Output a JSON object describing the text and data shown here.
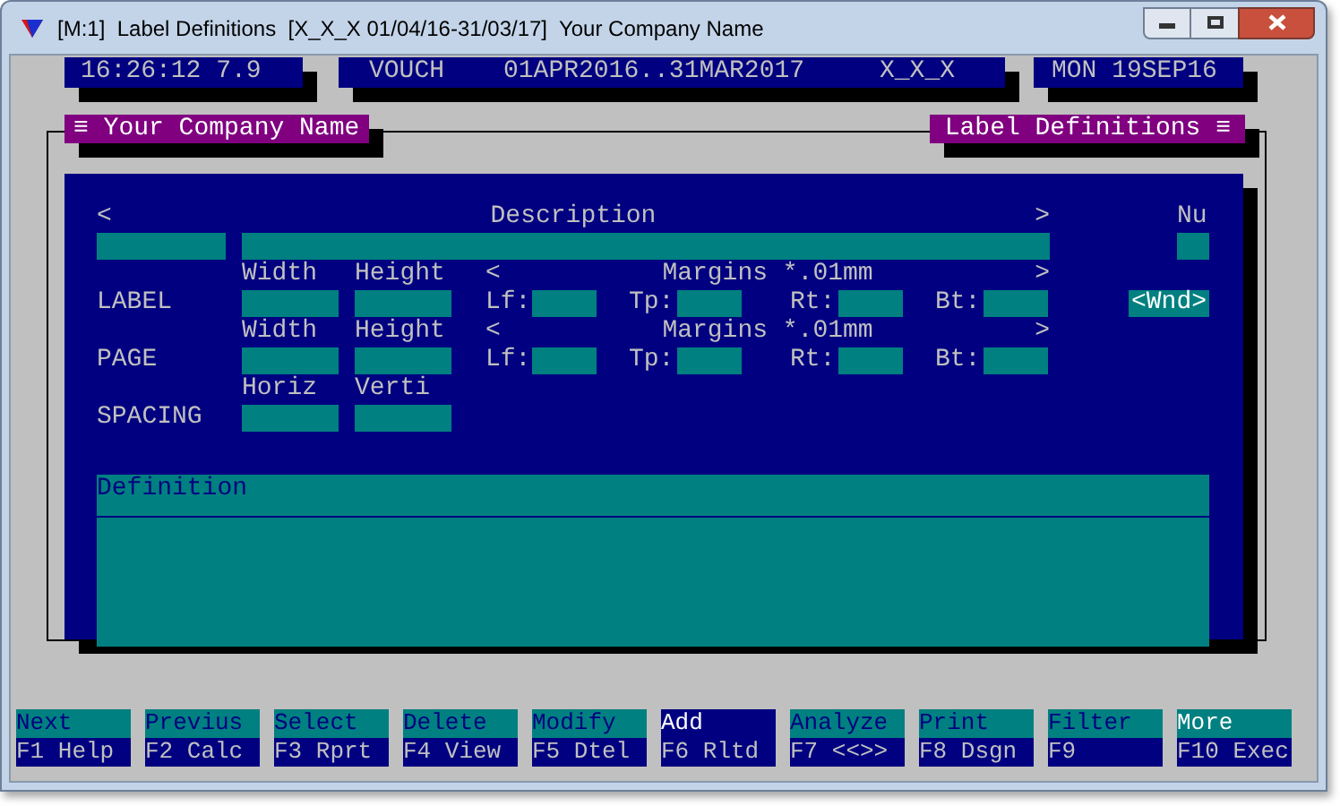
{
  "window": {
    "title": "[M:1]  Label Definitions  [X_X_X 01/04/16-31/03/17]  Your Company Name"
  },
  "status": {
    "time": "16:26:12 7.9",
    "module": "VOUCH",
    "period": "01APR2016..31MAR2017",
    "company_code": "X_X_X",
    "date": "MON 19SEP16"
  },
  "panel": {
    "left_title": "≡ Your Company Name",
    "right_title": "Label Definitions ≡"
  },
  "form": {
    "description_header": {
      "left": "<",
      "title": "Description",
      "right": ">"
    },
    "number_header": "Nu",
    "rows": [
      {
        "label": "LABEL",
        "col1": "Width",
        "col2": "Height",
        "margins_left": "<",
        "margins_title": "Margins *.01mm",
        "margins_right": ">",
        "lf": "Lf:",
        "tp": "Tp:",
        "rt": "Rt:",
        "bt": "Bt:",
        "button": "<Wnd>"
      },
      {
        "label": "PAGE",
        "col1": "Width",
        "col2": "Height",
        "margins_left": "<",
        "margins_title": "Margins *.01mm",
        "margins_right": ">",
        "lf": "Lf:",
        "tp": "Tp:",
        "rt": "Rt:",
        "bt": "Bt:"
      },
      {
        "label": "SPACING",
        "col1": "Horiz",
        "col2": "Verti"
      }
    ],
    "definition_label": "Definition"
  },
  "function_keys": [
    {
      "action": "Next",
      "key": "F1 Help",
      "selected": false
    },
    {
      "action": "Previus",
      "key": "F2 Calc",
      "selected": false
    },
    {
      "action": "Select",
      "key": "F3 Rprt",
      "selected": false
    },
    {
      "action": "Delete",
      "key": "F4 View",
      "selected": false
    },
    {
      "action": "Modify",
      "key": "F5 Dtel",
      "selected": false
    },
    {
      "action": "Add",
      "key": "F6 Rltd",
      "selected": true
    },
    {
      "action": "Analyze",
      "key": "F7 <<>>",
      "selected": false
    },
    {
      "action": "Print",
      "key": "F8 Dsgn",
      "selected": false
    },
    {
      "action": "Filter",
      "key": "F9",
      "selected": false
    },
    {
      "action": "More",
      "key": "F10 Exec",
      "selected": false,
      "highlight": true
    }
  ]
}
